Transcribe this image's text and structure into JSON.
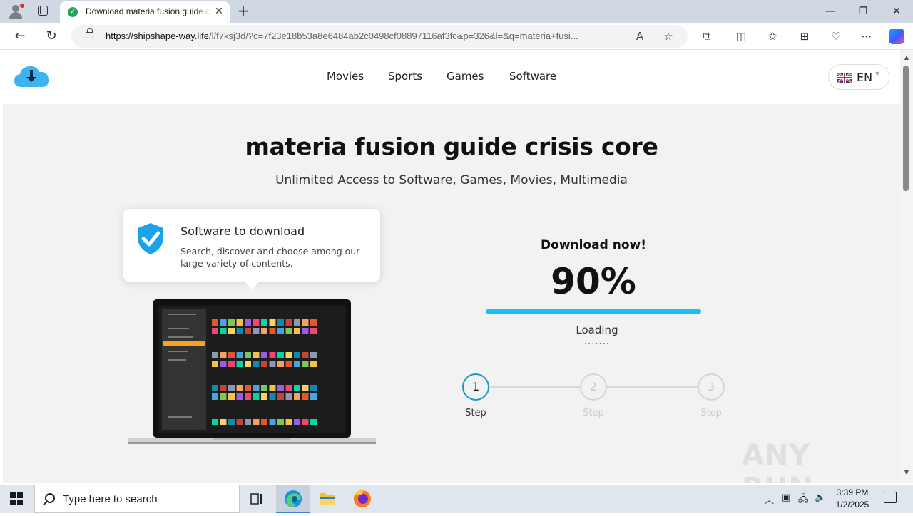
{
  "browser": {
    "tab_title": "Download materia fusion guide crisis core",
    "tab_close": "✕",
    "new_tab": "+",
    "url_host": "https://shipshape-way.life",
    "url_path": "/l/f7ksj3d/?c=7f23e18b53a8e6484ab2c0498cf08897116af3fc&p=326&l=&q=materia+fusi...",
    "icons": [
      "back-arrow-icon",
      "refresh-icon",
      "lock-icon",
      "read-aloud-icon",
      "favorite-star-icon",
      "extensions-icon",
      "split-screen-icon",
      "favorites-icon",
      "collections-icon",
      "browser-essentials-icon",
      "more-icon",
      "copilot-icon"
    ]
  },
  "site": {
    "nav": [
      "Movies",
      "Sports",
      "Games",
      "Software"
    ],
    "language": "EN",
    "accent_color": "#15c1f2",
    "title": "materia fusion guide crisis core",
    "subtitle": "Unlimited Access to Software, Games, Movies, Multimedia",
    "bubble_title": "Software to download",
    "bubble_text": "Search, discover and choose among our large variety of contents.",
    "download_heading": "Download now!",
    "percent_label": "90%",
    "progress": 1.0,
    "loading_label": "Loading",
    "dots": ".......",
    "steps": [
      {
        "number": "1",
        "label": "Step",
        "active": true
      },
      {
        "number": "2",
        "label": "Step",
        "active": false
      },
      {
        "number": "3",
        "label": "Step",
        "active": false
      }
    ],
    "watermark": "ANY RUN"
  },
  "taskbar": {
    "search_placeholder": "Type here to search",
    "time": "3:39 PM",
    "date": "1/2/2025",
    "apps": [
      "task-view-icon",
      "edge-icon",
      "file-explorer-icon",
      "firefox-icon"
    ]
  }
}
